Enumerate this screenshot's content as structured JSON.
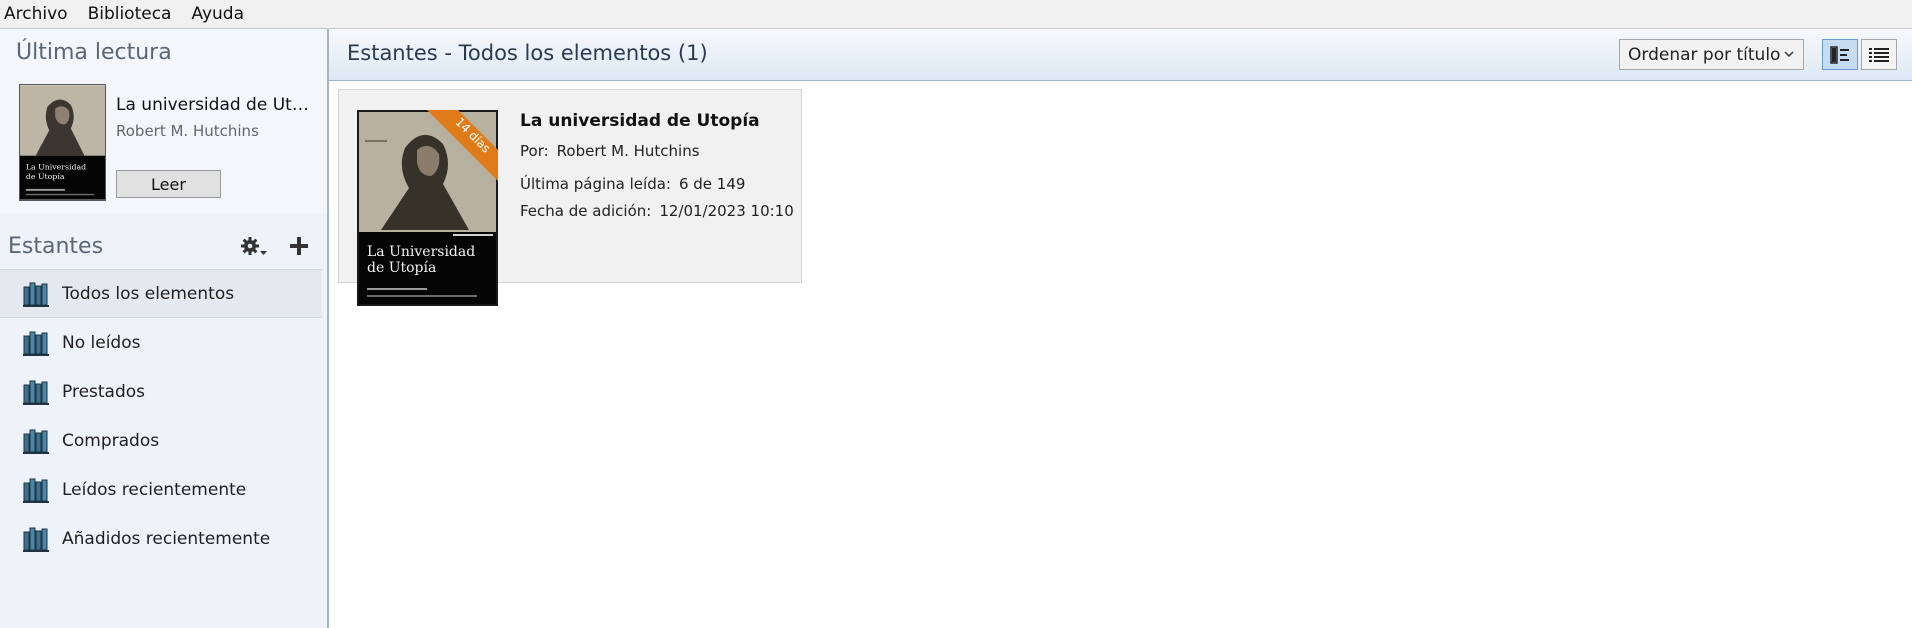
{
  "menu": {
    "items": [
      "Archivo",
      "Biblioteca",
      "Ayuda"
    ]
  },
  "sidebar": {
    "last_read": {
      "title": "Última lectura",
      "book_title": "La universidad de Uto...",
      "book_author": "Robert M. Hutchins",
      "read_button": "Leer"
    },
    "shelves": {
      "title": "Estantes",
      "items": [
        {
          "label": "Todos los elementos",
          "selected": true
        },
        {
          "label": "No leídos"
        },
        {
          "label": "Prestados"
        },
        {
          "label": "Comprados"
        },
        {
          "label": "Leídos recientemente"
        },
        {
          "label": "Añadidos recientemente"
        }
      ]
    }
  },
  "main": {
    "header_title": "Estantes - Todos los elementos (1)",
    "sort_label": "Ordenar por título",
    "book": {
      "title": "La universidad de Utopía",
      "author_label": "Por:",
      "author": "Robert M. Hutchins",
      "last_page_label": "Última página leída:",
      "last_page_value": "6 de 149",
      "added_label": "Fecha de adición:",
      "added_value": "12/01/2023 10:10",
      "ribbon": "14 días",
      "cover_text": [
        "La Universidad",
        "de Utopía"
      ]
    }
  },
  "colors": {
    "ribbon": "#e07b1a",
    "shelf_icon": "#3e6f8c",
    "selected_view": "#c5dcf1"
  },
  "icons": {
    "shelf": "bookshelf-icon",
    "settings": "gear-icon",
    "add": "plus-icon",
    "grid": "grid-view-icon",
    "list": "list-view-icon"
  }
}
